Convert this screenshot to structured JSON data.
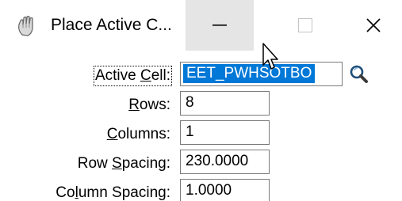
{
  "window": {
    "title": "Place Active C...",
    "minimize_glyph": "—",
    "maximize_glyph": "☐",
    "close_glyph": "✕"
  },
  "icons": {
    "app_icon": "hand-cell-icon",
    "search": "magnifier-icon",
    "cursor": "mouse-pointer-icon"
  },
  "colors": {
    "selection": "#0078d7",
    "minimize_hover": "#e5e5e5"
  },
  "form": {
    "active_cell": {
      "label_pre": "Active ",
      "label_accel": "C",
      "label_post": "ell:",
      "value": "EET_PWHSOTBO"
    },
    "rows": {
      "label_pre": "",
      "label_accel": "R",
      "label_post": "ows:",
      "value": "8"
    },
    "columns": {
      "label_pre": "",
      "label_accel": "C",
      "label_post": "olumns:",
      "value": "1"
    },
    "row_spacing": {
      "label_pre": "Row ",
      "label_accel": "S",
      "label_post": "pacing:",
      "value": "230.0000"
    },
    "column_spacing": {
      "label_pre": "Co",
      "label_accel": "l",
      "label_post": "umn Spacing:",
      "value": "1.0000"
    }
  }
}
